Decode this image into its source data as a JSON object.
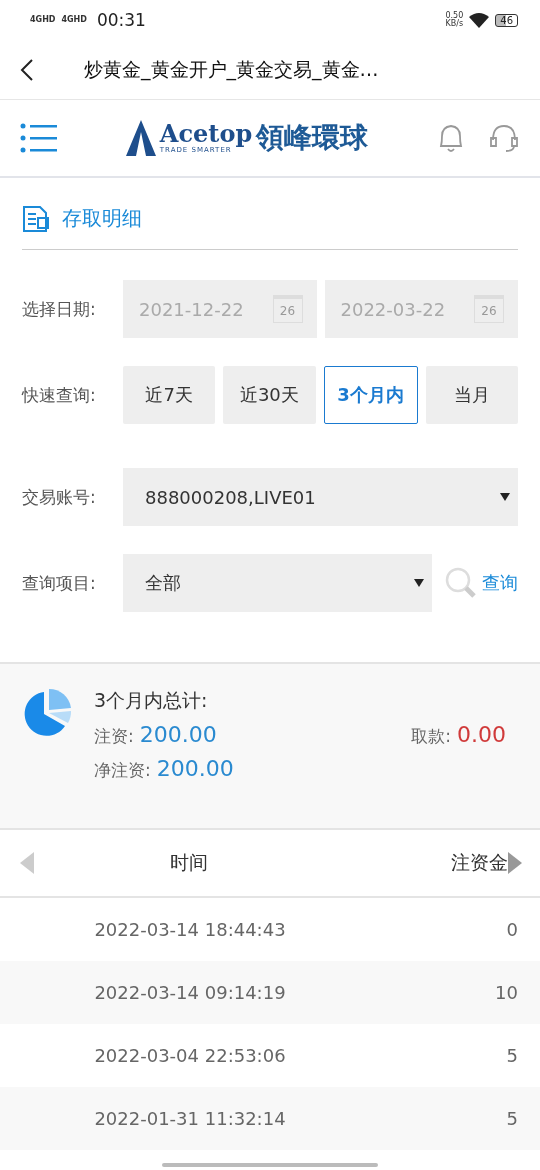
{
  "status_bar": {
    "signal_1": "4GHD",
    "signal_2": "4GHD",
    "time": "00:31",
    "speed": "0.50",
    "speed_unit": "KB/s",
    "battery": "46"
  },
  "title_bar": {
    "title": "炒黄金_黄金开户_黄金交易_黄金…"
  },
  "header": {
    "logo_name": "Acetop",
    "logo_tagline": "TRADE SMARTER",
    "logo_chinese": "領峰環球"
  },
  "section": {
    "title": "存取明细"
  },
  "date_filter": {
    "label": "选择日期:",
    "start": "2021-12-22",
    "start_calendar_day": "26",
    "end": "2022-03-22",
    "end_calendar_day": "26"
  },
  "quick_filter": {
    "label": "快速查询:",
    "options": [
      {
        "label": "近7天",
        "selected": false
      },
      {
        "label": "近30天",
        "selected": false
      },
      {
        "label": "3个月内",
        "selected": true
      },
      {
        "label": "当月",
        "selected": false
      }
    ]
  },
  "account": {
    "label": "交易账号:",
    "value": "888000208,LIVE01"
  },
  "item_filter": {
    "label": "查询项目:",
    "value": "全部",
    "search_button": "查询"
  },
  "summary": {
    "title": "3个月内总计:",
    "deposit_label": "注资:",
    "deposit": "200.00",
    "withdraw_label": "取款:",
    "withdraw": "0.00",
    "net_label": "净注资:",
    "net": "200.00"
  },
  "table": {
    "columns": [
      "时间",
      "注资金"
    ],
    "prev_enabled": false,
    "next_enabled": true,
    "rows": [
      {
        "time": "2022-03-14 18:44:43",
        "amount": "0"
      },
      {
        "time": "2022-03-14 09:14:19",
        "amount": "10"
      },
      {
        "time": "2022-03-04 22:53:06",
        "amount": "5"
      },
      {
        "time": "2022-01-31 11:32:14",
        "amount": "5"
      }
    ]
  }
}
